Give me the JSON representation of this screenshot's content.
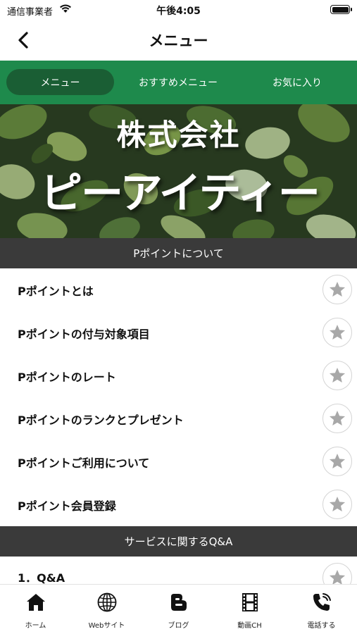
{
  "status_bar": {
    "carrier": "通信事業者",
    "time": "午後4:05"
  },
  "nav": {
    "title": "メニュー"
  },
  "tabs": [
    {
      "label": "メニュー",
      "active": true
    },
    {
      "label": "おすすめメニュー",
      "active": false
    },
    {
      "label": "お気に入り",
      "active": false
    }
  ],
  "banner": {
    "line1": "株式会社",
    "line2": "ピーアイティー"
  },
  "sections": [
    {
      "header": "Pポイントについて",
      "items": [
        {
          "label": "Pポイントとは"
        },
        {
          "label": "Pポイントの付与対象項目"
        },
        {
          "label": "Pポイントのレート"
        },
        {
          "label": "Pポイントのランクとプレゼント"
        },
        {
          "label": "Pポイントご利用について"
        },
        {
          "label": "Pポイント会員登録"
        }
      ]
    },
    {
      "header": "サービスに関するQ&A",
      "items": [
        {
          "label": "1．Q&A"
        }
      ]
    }
  ],
  "tabbar": [
    {
      "label": "ホーム",
      "icon": "home-icon"
    },
    {
      "label": "Webサイト",
      "icon": "globe-icon"
    },
    {
      "label": "ブログ",
      "icon": "blogger-icon"
    },
    {
      "label": "動画CH",
      "icon": "film-icon"
    },
    {
      "label": "電話する",
      "icon": "phone-icon"
    }
  ],
  "colors": {
    "brand_green": "#1e8a4c",
    "active_tab": "#1a5e34",
    "section_header": "#3a3a3a",
    "star": "#a8a8a8"
  }
}
